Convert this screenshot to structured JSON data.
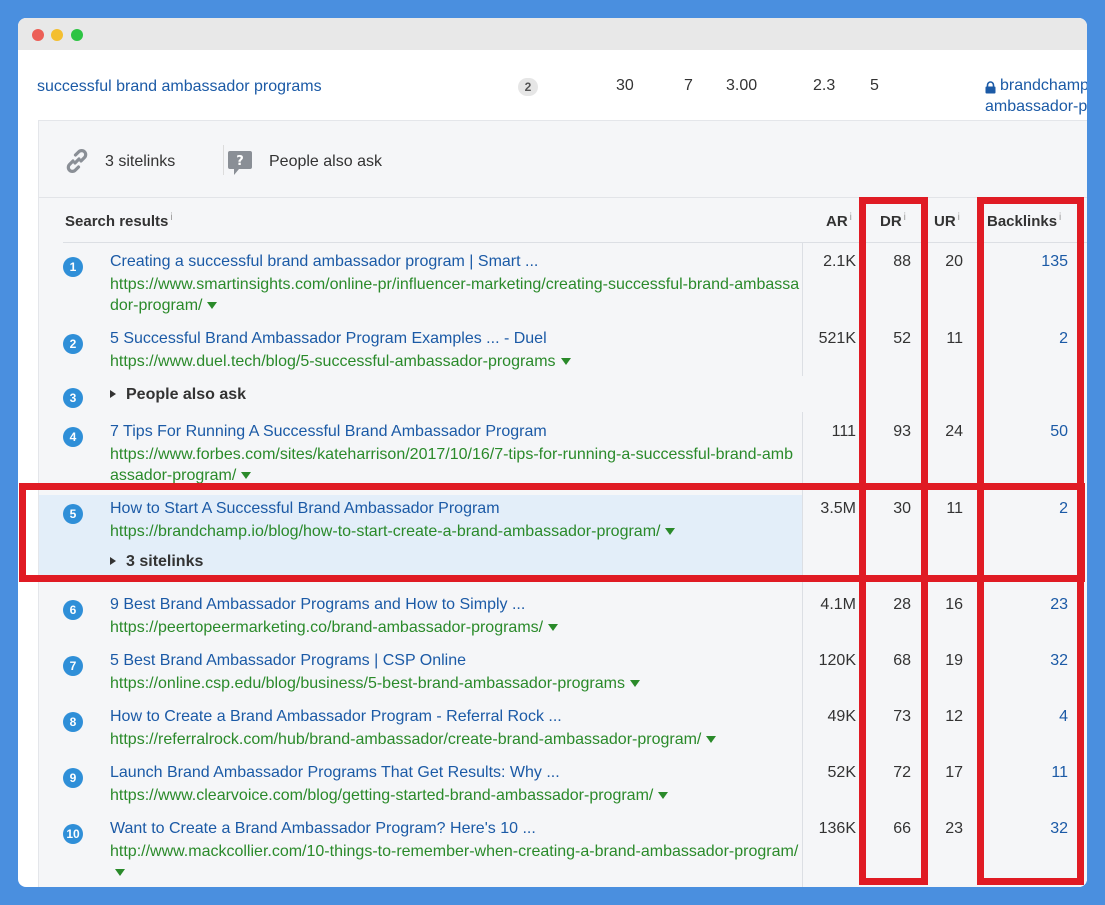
{
  "keyword_row": {
    "keyword": "successful brand ambassador programs",
    "badge": "2",
    "n1": "30",
    "n2": "7",
    "n3": "3.00",
    "n4": "2.3",
    "n5": "5",
    "url_part1": "brandchamp",
    "url_part2": "ambassador-p"
  },
  "tabs": [
    {
      "label": "3 sitelinks",
      "icon": "link-icon"
    },
    {
      "label": "People also ask",
      "icon": "question-bubble-icon"
    }
  ],
  "headers": {
    "search_results": "Search results",
    "ar": "AR",
    "dr": "DR",
    "ur": "UR",
    "backlinks": "Backlinks",
    "info": "i"
  },
  "results": [
    {
      "num": "1",
      "title": "Creating a successful brand ambassador program | Smart ...",
      "url": "https://www.smartinsights.com/online-pr/influencer-marketing/creating-successful-brand-ambassador-program/",
      "ar": "2.1K",
      "dr": "88",
      "ur": "20",
      "backlinks": "135"
    },
    {
      "num": "2",
      "title": "5 Successful Brand Ambassador Program Examples ... - Duel",
      "url": "https://www.duel.tech/blog/5-successful-ambassador-programs",
      "ar": "521K",
      "dr": "52",
      "ur": "11",
      "backlinks": "2"
    },
    {
      "num": "3",
      "expand": "People also ask"
    },
    {
      "num": "4",
      "title": "7 Tips For Running A Successful Brand Ambassador Program",
      "url": "https://www.forbes.com/sites/kateharrison/2017/10/16/7-tips-for-running-a-successful-brand-ambassador-program/",
      "ar": "111",
      "dr": "93",
      "ur": "24",
      "backlinks": "50"
    },
    {
      "num": "5",
      "title": "How to Start A Successful Brand Ambassador Program",
      "url": "https://brandchamp.io/blog/how-to-start-create-a-brand-ambassador-program/",
      "ar": "3.5M",
      "dr": "30",
      "ur": "11",
      "backlinks": "2",
      "sub": "3 sitelinks"
    },
    {
      "num": "6",
      "title": "9 Best Brand Ambassador Programs and How to Simply ...",
      "url": "https://peertopeermarketing.co/brand-ambassador-programs/",
      "ar": "4.1M",
      "dr": "28",
      "ur": "16",
      "backlinks": "23"
    },
    {
      "num": "7",
      "title": "5 Best Brand Ambassador Programs | CSP Online",
      "url": "https://online.csp.edu/blog/business/5-best-brand-ambassador-programs",
      "ar": "120K",
      "dr": "68",
      "ur": "19",
      "backlinks": "32"
    },
    {
      "num": "8",
      "title": "How to Create a Brand Ambassador Program - Referral Rock ...",
      "url": "https://referralrock.com/hub/brand-ambassador/create-brand-ambassador-program/",
      "ar": "49K",
      "dr": "73",
      "ur": "12",
      "backlinks": "4"
    },
    {
      "num": "9",
      "title": "Launch Brand Ambassador Programs That Get Results: Why ...",
      "url": "https://www.clearvoice.com/blog/getting-started-brand-ambassador-program/",
      "ar": "52K",
      "dr": "72",
      "ur": "17",
      "backlinks": "11"
    },
    {
      "num": "10",
      "title": "Want to Create a Brand Ambassador Program? Here's 10 ...",
      "url": "http://www.mackcollier.com/10-things-to-remember-when-creating-a-brand-ambassador-program/",
      "ar": "136K",
      "dr": "66",
      "ur": "23",
      "backlinks": "32"
    }
  ],
  "colors": {
    "highlight": "#e01b24",
    "link": "#1b5aa6",
    "url_green": "#2a8a2a",
    "badge_blue": "#2f8fd8",
    "selected_row": "#e3eef9"
  }
}
